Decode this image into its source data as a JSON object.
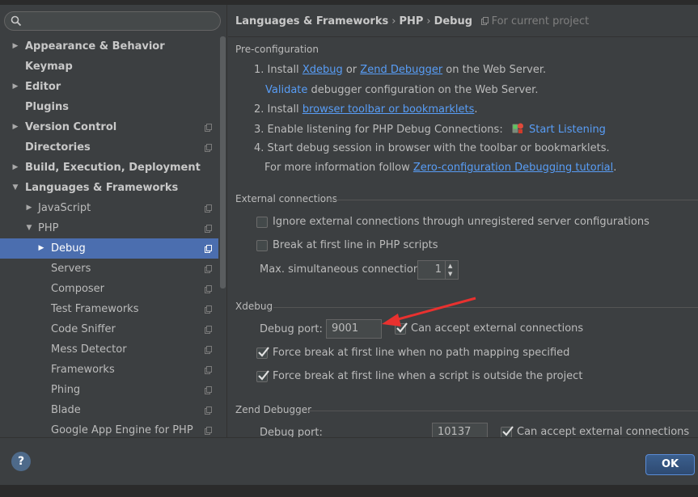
{
  "sidebar": {
    "search": {
      "placeholder": "",
      "value": ""
    },
    "items": [
      {
        "label": "Appearance & Behavior",
        "bold": true,
        "arrow": "▶",
        "indent": 0,
        "proj": false,
        "selected": false
      },
      {
        "label": "Keymap",
        "bold": true,
        "arrow": "",
        "indent": 0,
        "proj": false,
        "selected": false
      },
      {
        "label": "Editor",
        "bold": true,
        "arrow": "▶",
        "indent": 0,
        "proj": false,
        "selected": false
      },
      {
        "label": "Plugins",
        "bold": true,
        "arrow": "",
        "indent": 0,
        "proj": false,
        "selected": false
      },
      {
        "label": "Version Control",
        "bold": true,
        "arrow": "▶",
        "indent": 0,
        "proj": true,
        "selected": false
      },
      {
        "label": "Directories",
        "bold": true,
        "arrow": "",
        "indent": 0,
        "proj": true,
        "selected": false
      },
      {
        "label": "Build, Execution, Deployment",
        "bold": true,
        "arrow": "▶",
        "indent": 0,
        "proj": false,
        "selected": false
      },
      {
        "label": "Languages & Frameworks",
        "bold": true,
        "arrow": "▼",
        "indent": 0,
        "proj": false,
        "selected": false
      },
      {
        "label": "JavaScript",
        "bold": false,
        "arrow": "▶",
        "indent": 1,
        "proj": true,
        "selected": false
      },
      {
        "label": "PHP",
        "bold": false,
        "arrow": "▼",
        "indent": 1,
        "proj": true,
        "selected": false
      },
      {
        "label": "Debug",
        "bold": false,
        "arrow": "▶",
        "indent": 2,
        "proj": true,
        "selected": true
      },
      {
        "label": "Servers",
        "bold": false,
        "arrow": "",
        "indent": 2,
        "proj": true,
        "selected": false
      },
      {
        "label": "Composer",
        "bold": false,
        "arrow": "",
        "indent": 2,
        "proj": true,
        "selected": false
      },
      {
        "label": "Test Frameworks",
        "bold": false,
        "arrow": "",
        "indent": 2,
        "proj": true,
        "selected": false
      },
      {
        "label": "Code Sniffer",
        "bold": false,
        "arrow": "",
        "indent": 2,
        "proj": true,
        "selected": false
      },
      {
        "label": "Mess Detector",
        "bold": false,
        "arrow": "",
        "indent": 2,
        "proj": true,
        "selected": false
      },
      {
        "label": "Frameworks",
        "bold": false,
        "arrow": "",
        "indent": 2,
        "proj": true,
        "selected": false
      },
      {
        "label": "Phing",
        "bold": false,
        "arrow": "",
        "indent": 2,
        "proj": true,
        "selected": false
      },
      {
        "label": "Blade",
        "bold": false,
        "arrow": "",
        "indent": 2,
        "proj": true,
        "selected": false
      },
      {
        "label": "Google App Engine for PHP",
        "bold": false,
        "arrow": "",
        "indent": 2,
        "proj": true,
        "selected": false
      }
    ]
  },
  "header": {
    "crumb1": "Languages & Frameworks",
    "crumb2": "PHP",
    "crumb3": "Debug",
    "sep": "›",
    "note": "For current project"
  },
  "preconfig": {
    "title": "Pre-configuration",
    "step1_prefix": "1. Install ",
    "step1_link1": "Xdebug",
    "step1_or": " or ",
    "step1_link2": "Zend Debugger",
    "step1_suffix": " on the Web Server.",
    "validate_link": "Validate",
    "validate_suffix": " debugger configuration on the Web Server.",
    "step2_prefix": "2. Install ",
    "step2_link": "browser toolbar or bookmarklets",
    "step2_suffix": ".",
    "step3_text": "3. Enable listening for PHP Debug Connections:",
    "step3_link": "Start Listening",
    "step4_text": "4. Start debug session in browser with the toolbar or bookmarklets.",
    "more_prefix": "For more information follow ",
    "more_link": "Zero-configuration Debugging tutorial",
    "more_suffix": "."
  },
  "external": {
    "title": "External connections",
    "ignore_label": "Ignore external connections through unregistered server configurations",
    "ignore_checked": false,
    "break_label": "Break at first line in PHP scripts",
    "break_checked": false,
    "max_label": "Max. simultaneous connections:",
    "max_value": "1"
  },
  "xdebug": {
    "title": "Xdebug",
    "port_label": "Debug port:",
    "port_value": "9001",
    "accept_label": "Can accept external connections",
    "accept_checked": true,
    "force1_label": "Force break at first line when no path mapping specified",
    "force1_checked": true,
    "force2_label": "Force break at first line when a script is outside the project",
    "force2_checked": true
  },
  "zend": {
    "title": "Zend Debugger",
    "port_label": "Debug port:",
    "port_value": "10137",
    "accept_label": "Can accept external connections",
    "accept_checked": true
  },
  "footer": {
    "help_label": "?",
    "ok_label": "OK"
  },
  "colors": {
    "accent": "#4b6eaf",
    "link": "#589df6",
    "annotation_arrow": "#e8312f"
  }
}
